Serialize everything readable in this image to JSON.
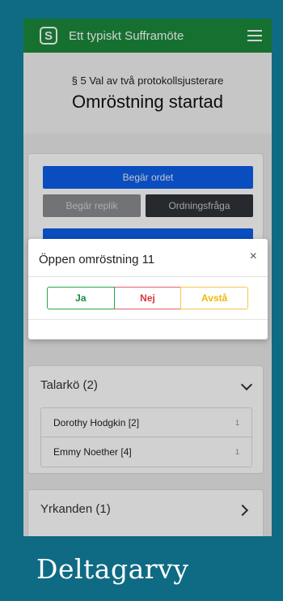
{
  "navbar": {
    "logo": "S",
    "title": "Ett typiskt Sufframöte"
  },
  "agenda": {
    "item": "§ 5 Val av två protokollsjusterare",
    "status": "Omröstning startad"
  },
  "actions": {
    "request_floor": "Begär ordet",
    "reply": "Begär replik",
    "point_of_order": "Ordningsfråga"
  },
  "speakers": {
    "title": "Talarkö (2)",
    "items": [
      {
        "name": "Dorothy Hodgkin [2]",
        "count": "1"
      },
      {
        "name": "Emmy Noether [4]",
        "count": "1"
      }
    ]
  },
  "motions": {
    "title": "Yrkanden (1)"
  },
  "modal": {
    "title": "Öppen omröstning 11",
    "close": "×",
    "options": {
      "yes": "Ja",
      "no": "Nej",
      "abstain": "Avstå"
    }
  },
  "caption": "Deltagarvy",
  "colors": {
    "background": "#0f6b84",
    "navbar": "#1c8a3c",
    "primary": "#0d5eea",
    "yes": "#28a745",
    "no": "#dc3545",
    "abstain": "#f0b90b"
  },
  "icons": {
    "logo": "s-logo-icon",
    "menu": "hamburger-menu-icon",
    "expand": "chevron-down-icon",
    "open": "chevron-right-icon",
    "close": "close-icon"
  }
}
